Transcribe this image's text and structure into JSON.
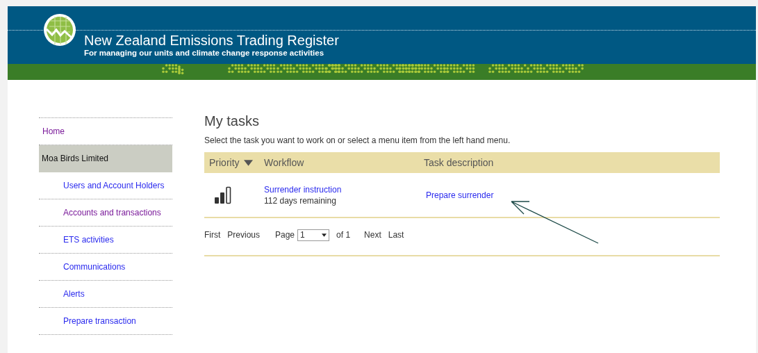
{
  "header": {
    "title": "New Zealand Emissions Trading Register",
    "subtitle": "For managing our units and climate change response activities"
  },
  "sidebar": {
    "items": [
      {
        "label": "Home",
        "kind": "link",
        "selected": false,
        "visited": true
      },
      {
        "label": "Moa Birds Limited",
        "kind": "heading",
        "selected": true,
        "visited": false
      },
      {
        "label": "Users and Account Holders",
        "kind": "sublink",
        "selected": false,
        "visited": false
      },
      {
        "label": "Accounts and transactions",
        "kind": "sublink",
        "selected": false,
        "visited": true
      },
      {
        "label": "ETS activities",
        "kind": "sublink",
        "selected": false,
        "visited": false
      },
      {
        "label": "Communications",
        "kind": "sublink",
        "selected": false,
        "visited": false
      },
      {
        "label": "Alerts",
        "kind": "sublink",
        "selected": false,
        "visited": false
      },
      {
        "label": "Prepare transaction",
        "kind": "sublink",
        "selected": false,
        "visited": false
      }
    ]
  },
  "main": {
    "title": "My tasks",
    "intro": "Select the task you want to work on or select a menu item from the left hand menu.",
    "table": {
      "columns": [
        "Priority",
        "Workflow",
        "Task description"
      ],
      "rows": [
        {
          "workflow": "Surrender instruction",
          "remaining": "112 days remaining",
          "task": "Prepare surrender"
        }
      ]
    },
    "pagination": {
      "first": "First",
      "previous": "Previous",
      "page_label": "Page",
      "page": "1",
      "of": "of",
      "total": "1",
      "next": "Next",
      "last": "Last"
    }
  }
}
